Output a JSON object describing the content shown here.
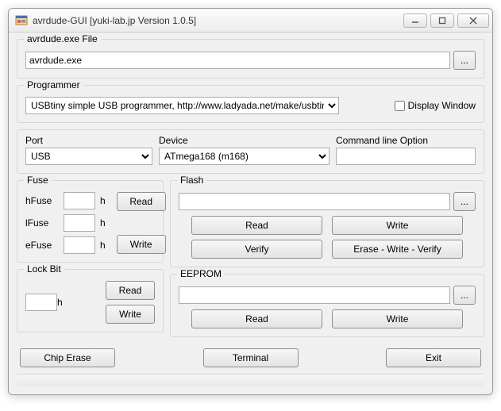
{
  "window": {
    "title": "avrdude-GUI [yuki-lab.jp Version 1.0.5]"
  },
  "file": {
    "caption": "avrdude.exe File",
    "value": "avrdude.exe",
    "browse": "..."
  },
  "programmer": {
    "caption": "Programmer",
    "selected": "USBtiny simple USB programmer, http://www.ladyada.net/make/usbtinyis",
    "display_window_label": "Display Window",
    "display_window_checked": false
  },
  "port": {
    "label": "Port",
    "selected": "USB"
  },
  "device": {
    "label": "Device",
    "selected": "ATmega168 (m168)"
  },
  "cmdline": {
    "label": "Command line Option",
    "value": ""
  },
  "fuse": {
    "caption": "Fuse",
    "hfuse_label": "hFuse",
    "lfuse_label": "lFuse",
    "efuse_label": "eFuse",
    "hfuse_value": "",
    "lfuse_value": "",
    "efuse_value": "",
    "unit": "h",
    "read_label": "Read",
    "write_label": "Write"
  },
  "lock": {
    "caption": "Lock Bit",
    "value": "",
    "unit": "h",
    "read_label": "Read",
    "write_label": "Write"
  },
  "flash": {
    "caption": "Flash",
    "path": "",
    "browse": "...",
    "read_label": "Read",
    "write_label": "Write",
    "verify_label": "Verify",
    "ewv_label": "Erase - Write - Verify"
  },
  "eeprom": {
    "caption": "EEPROM",
    "path": "",
    "browse": "...",
    "read_label": "Read",
    "write_label": "Write"
  },
  "bottom": {
    "chip_erase": "Chip Erase",
    "terminal": "Terminal",
    "exit": "Exit"
  }
}
